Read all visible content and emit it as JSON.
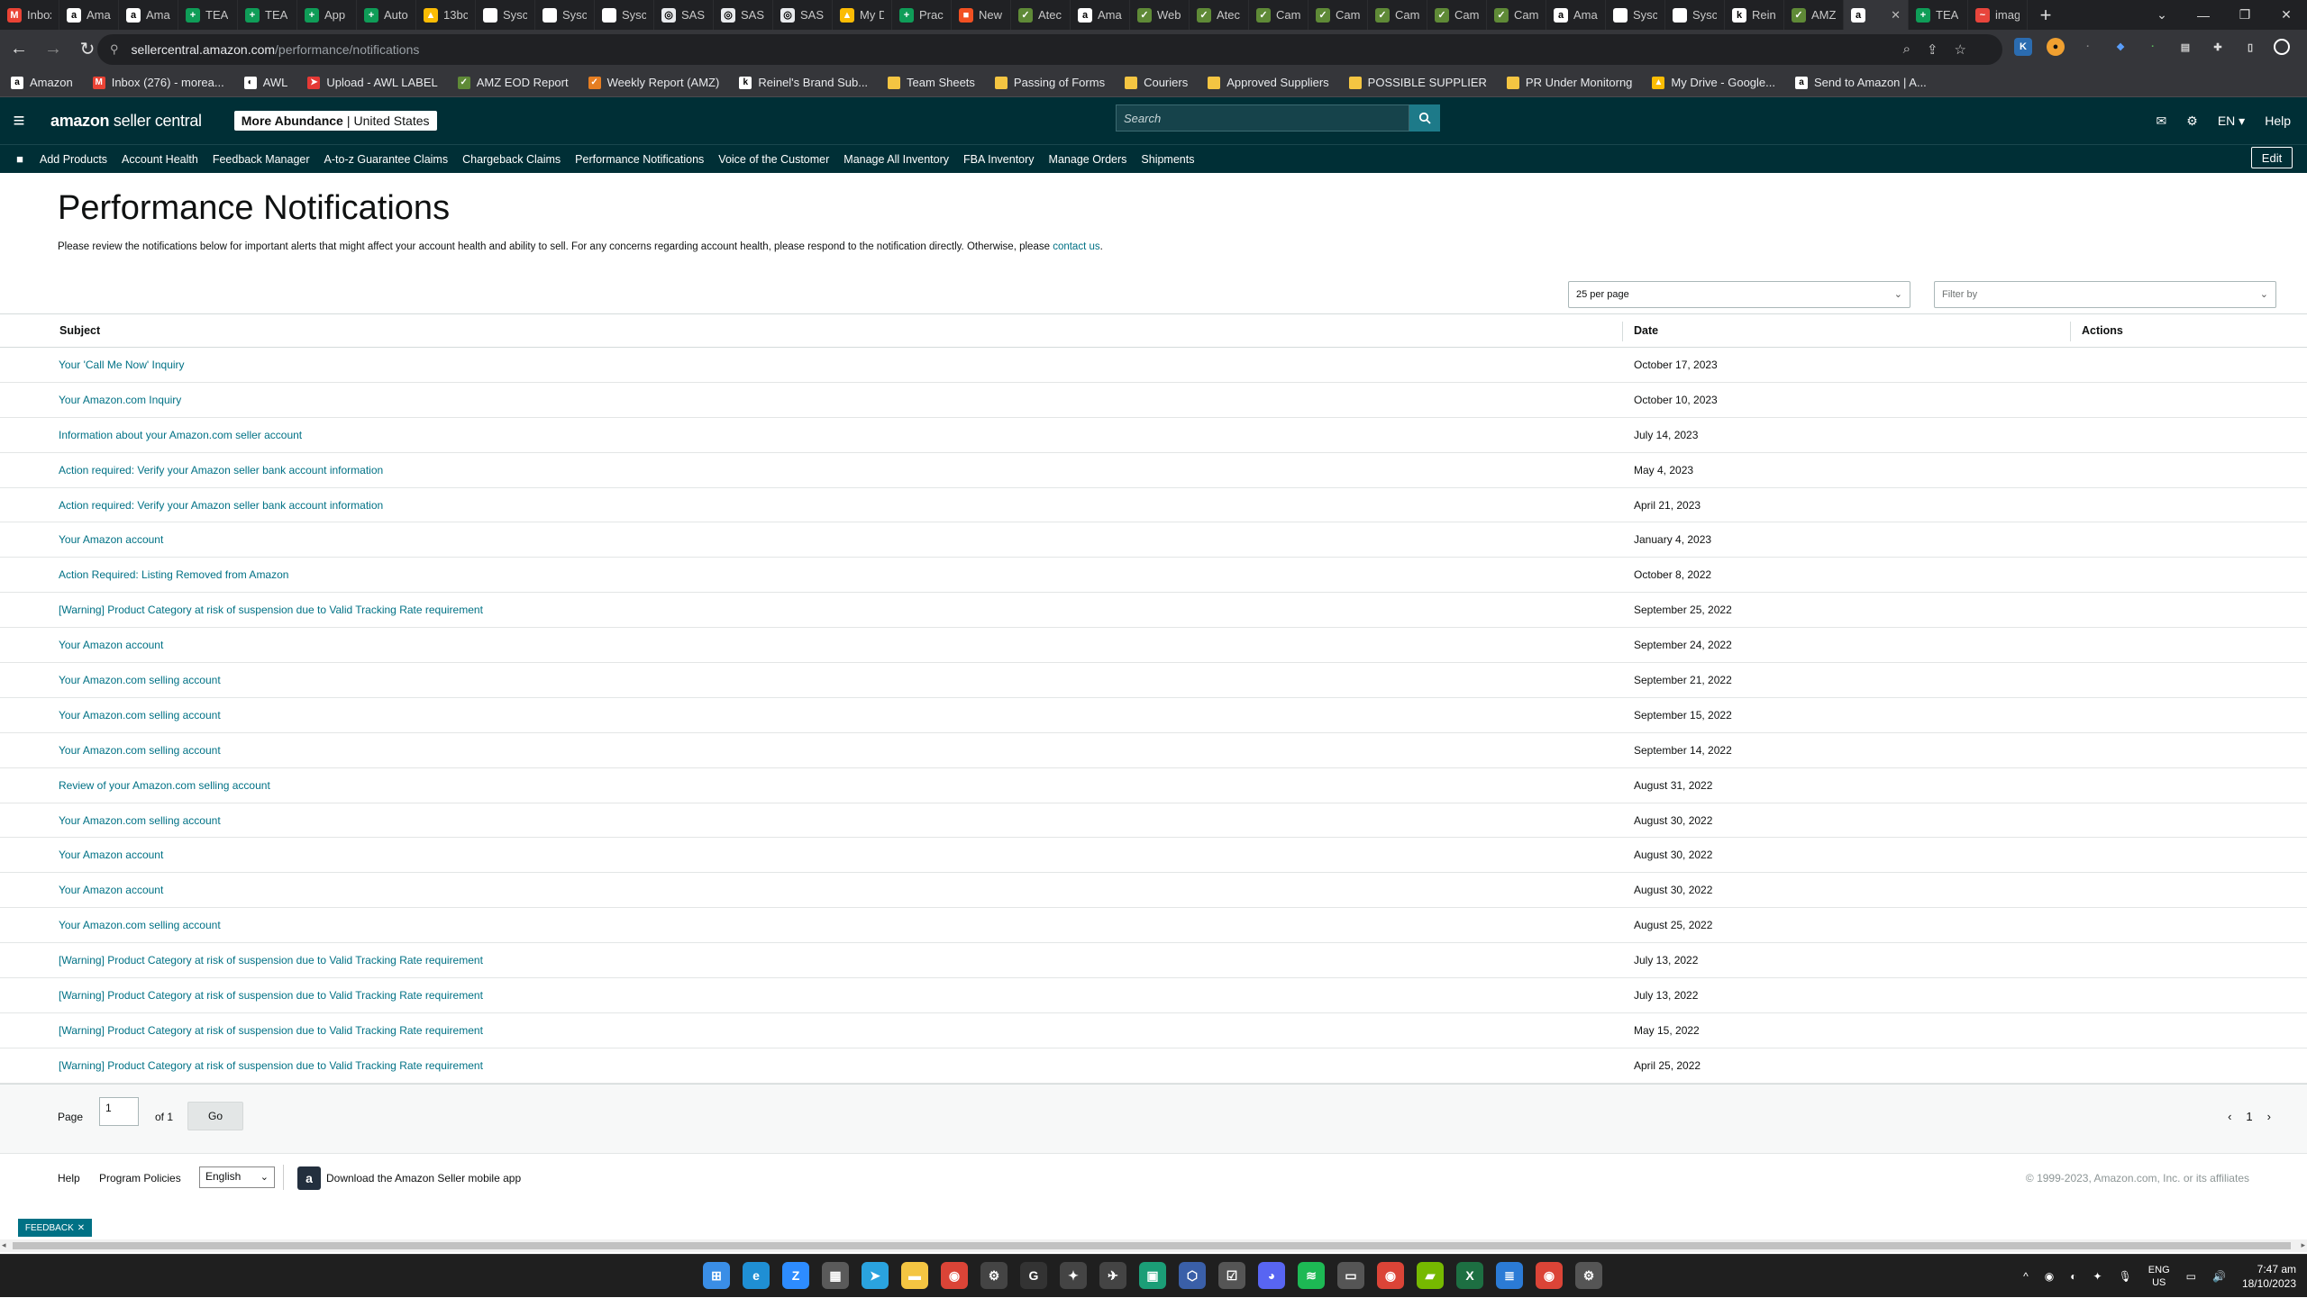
{
  "browser": {
    "tabs": [
      {
        "label": "Inbox",
        "icon": "gmail-icon",
        "color": "#ea4335",
        "glyph": "M"
      },
      {
        "label": "Ama",
        "icon": "amazon-icon",
        "color": "#ffffff",
        "glyph": "a"
      },
      {
        "label": "Ama",
        "icon": "amazon-icon",
        "color": "#ffffff",
        "glyph": "a"
      },
      {
        "label": "TEA",
        "icon": "sheets-icon",
        "color": "#0f9d58",
        "glyph": "+"
      },
      {
        "label": "TEA",
        "icon": "sheets-icon",
        "color": "#0f9d58",
        "glyph": "+"
      },
      {
        "label": "App",
        "icon": "sheets-icon",
        "color": "#0f9d58",
        "glyph": "+"
      },
      {
        "label": "Auto",
        "icon": "sheets-icon",
        "color": "#0f9d58",
        "glyph": "+"
      },
      {
        "label": "13bc",
        "icon": "drive-icon",
        "color": "#fbbc04",
        "glyph": "▲"
      },
      {
        "label": "Sysc",
        "icon": "doc-icon",
        "color": "#ffffff",
        "glyph": ""
      },
      {
        "label": "Sysc",
        "icon": "doc-icon",
        "color": "#ffffff",
        "glyph": ""
      },
      {
        "label": "Sysc",
        "icon": "doc-icon",
        "color": "#ffffff",
        "glyph": ""
      },
      {
        "label": "SAS",
        "icon": "chrome-icon",
        "color": "#e8eaed",
        "glyph": "◎"
      },
      {
        "label": "SAS",
        "icon": "chrome-icon",
        "color": "#e8eaed",
        "glyph": "◎"
      },
      {
        "label": "SAS",
        "icon": "chrome-icon",
        "color": "#e8eaed",
        "glyph": "◎"
      },
      {
        "label": "My D",
        "icon": "drive-icon",
        "color": "#fbbc04",
        "glyph": "▲"
      },
      {
        "label": "Prac",
        "icon": "sheets-icon",
        "color": "#0f9d58",
        "glyph": "+"
      },
      {
        "label": "New",
        "icon": "windows-icon",
        "color": "#f25022",
        "glyph": "■"
      },
      {
        "label": "Atec",
        "icon": "web-icon",
        "color": "#5f8a37",
        "glyph": "✓"
      },
      {
        "label": "Ama",
        "icon": "amazon-icon",
        "color": "#ffffff",
        "glyph": "a"
      },
      {
        "label": "Web",
        "icon": "web-icon",
        "color": "#5f8a37",
        "glyph": "✓"
      },
      {
        "label": "Atec",
        "icon": "web-icon",
        "color": "#5f8a37",
        "glyph": "✓"
      },
      {
        "label": "Cam",
        "icon": "web-icon",
        "color": "#5f8a37",
        "glyph": "✓"
      },
      {
        "label": "Cam",
        "icon": "web-icon",
        "color": "#5f8a37",
        "glyph": "✓"
      },
      {
        "label": "Cam",
        "icon": "web-icon",
        "color": "#5f8a37",
        "glyph": "✓"
      },
      {
        "label": "Cam",
        "icon": "web-icon",
        "color": "#5f8a37",
        "glyph": "✓"
      },
      {
        "label": "Cam",
        "icon": "web-icon",
        "color": "#5f8a37",
        "glyph": "✓"
      },
      {
        "label": "Ama",
        "icon": "amazon-icon",
        "color": "#ffffff",
        "glyph": "a"
      },
      {
        "label": "Sysc",
        "icon": "doc-icon",
        "color": "#ffffff",
        "glyph": ""
      },
      {
        "label": "Sysc",
        "icon": "doc-icon",
        "color": "#ffffff",
        "glyph": ""
      },
      {
        "label": "Rein",
        "icon": "reinel-icon",
        "color": "#ffffff",
        "glyph": "k"
      },
      {
        "label": "AMZ",
        "icon": "web-icon",
        "color": "#5f8a37",
        "glyph": "✓"
      },
      {
        "label": "",
        "icon": "amazon-icon",
        "color": "#ffffff",
        "glyph": "a",
        "active": true
      },
      {
        "label": "TEA",
        "icon": "sheets-icon",
        "color": "#0f9d58",
        "glyph": "+"
      },
      {
        "label": "imag",
        "icon": "image-icon",
        "color": "#e8453c",
        "glyph": "~"
      }
    ],
    "url_host": "sellercentral.amazon.com",
    "url_path": "/performance/notifications",
    "bookmarks": [
      {
        "label": "Amazon",
        "icon": "amazon-icon",
        "color": "#ffffff",
        "glyph": "a"
      },
      {
        "label": "Inbox (276) - morea...",
        "icon": "gmail-icon",
        "color": "#ea4335",
        "glyph": "M"
      },
      {
        "label": "AWL",
        "icon": "awl-icon",
        "color": "#ffffff",
        "glyph": "◐"
      },
      {
        "label": "Upload - AWL LABEL",
        "icon": "upload-icon",
        "color": "#e53935",
        "glyph": "➤"
      },
      {
        "label": "AMZ EOD Report",
        "icon": "web-icon",
        "color": "#5f8a37",
        "glyph": "✓"
      },
      {
        "label": "Weekly Report (AMZ)",
        "icon": "report-icon",
        "color": "#e67e22",
        "glyph": "✓"
      },
      {
        "label": "Reinel's Brand Sub...",
        "icon": "reinel-icon",
        "color": "#ffffff",
        "glyph": "k"
      },
      {
        "label": "Team Sheets",
        "icon": "folder-icon",
        "color": "#f4c542",
        "glyph": ""
      },
      {
        "label": "Passing of Forms",
        "icon": "folder-icon",
        "color": "#f4c542",
        "glyph": ""
      },
      {
        "label": "Couriers",
        "icon": "folder-icon",
        "color": "#f4c542",
        "glyph": ""
      },
      {
        "label": "Approved Suppliers",
        "icon": "folder-icon",
        "color": "#f4c542",
        "glyph": ""
      },
      {
        "label": "POSSIBLE SUPPLIER",
        "icon": "folder-icon",
        "color": "#f4c542",
        "glyph": ""
      },
      {
        "label": "PR Under Monitorng",
        "icon": "folder-icon",
        "color": "#f4c542",
        "glyph": ""
      },
      {
        "label": "My Drive - Google...",
        "icon": "drive-icon",
        "color": "#fbbc04",
        "glyph": "▲"
      },
      {
        "label": "Send to Amazon | A...",
        "icon": "amazon-icon",
        "color": "#ffffff",
        "glyph": "a"
      }
    ]
  },
  "header": {
    "logo_brand": "amazon",
    "logo_rest": " seller central",
    "store_name": "More Abundance",
    "store_region": "United States",
    "search_placeholder": "Search",
    "lang": "EN",
    "help": "Help"
  },
  "nav": {
    "items": [
      "Add Products",
      "Account Health",
      "Feedback Manager",
      "A-to-z Guarantee Claims",
      "Chargeback Claims",
      "Performance Notifications",
      "Voice of the Customer",
      "Manage All Inventory",
      "FBA Inventory",
      "Manage Orders",
      "Shipments"
    ],
    "edit": "Edit"
  },
  "page": {
    "title": "Performance Notifications",
    "intro": "Please review the notifications below for important alerts that might affect your account health and ability to sell. For any concerns regarding account health, please respond to the notification directly. Otherwise, please ",
    "contact_link": "contact us",
    "intro_end": ".",
    "per_page": "25 per page",
    "filter_placeholder": "Filter by"
  },
  "table": {
    "headers": {
      "subject": "Subject",
      "date": "Date",
      "actions": "Actions"
    },
    "rows": [
      {
        "subject": "Your 'Call Me Now' Inquiry",
        "date": "October 17, 2023"
      },
      {
        "subject": "Your Amazon.com Inquiry",
        "date": "October 10, 2023"
      },
      {
        "subject": "Information about your Amazon.com seller account",
        "date": "July 14, 2023"
      },
      {
        "subject": "Action required: Verify your Amazon seller bank account information",
        "date": "May 4, 2023"
      },
      {
        "subject": "Action required: Verify your Amazon seller bank account information",
        "date": "April 21, 2023"
      },
      {
        "subject": "Your Amazon account",
        "date": "January 4, 2023"
      },
      {
        "subject": "Action Required: Listing Removed from Amazon",
        "date": "October 8, 2022"
      },
      {
        "subject": "[Warning] Product Category at risk of suspension due to Valid Tracking Rate requirement",
        "date": "September 25, 2022"
      },
      {
        "subject": "Your Amazon account",
        "date": "September 24, 2022"
      },
      {
        "subject": "Your Amazon.com selling account",
        "date": "September 21, 2022"
      },
      {
        "subject": "Your Amazon.com selling account",
        "date": "September 15, 2022"
      },
      {
        "subject": "Your Amazon.com selling account",
        "date": "September 14, 2022"
      },
      {
        "subject": "Review of your Amazon.com selling account",
        "date": "August 31, 2022"
      },
      {
        "subject": "Your Amazon.com selling account",
        "date": "August 30, 2022"
      },
      {
        "subject": "Your Amazon account",
        "date": "August 30, 2022"
      },
      {
        "subject": "Your Amazon account",
        "date": "August 30, 2022"
      },
      {
        "subject": "Your Amazon.com selling account",
        "date": "August 25, 2022"
      },
      {
        "subject": "[Warning] Product Category at risk of suspension due to Valid Tracking Rate requirement",
        "date": "July 13, 2022"
      },
      {
        "subject": "[Warning] Product Category at risk of suspension due to Valid Tracking Rate requirement",
        "date": "July 13, 2022"
      },
      {
        "subject": "[Warning] Product Category at risk of suspension due to Valid Tracking Rate requirement",
        "date": "May 15, 2022"
      },
      {
        "subject": "[Warning] Product Category at risk of suspension due to Valid Tracking Rate requirement",
        "date": "April 25, 2022"
      }
    ]
  },
  "pagination": {
    "page_label": "Page",
    "page_value": "1",
    "of_label": "of 1",
    "go": "Go",
    "current_page": "1"
  },
  "footer": {
    "help": "Help",
    "policies": "Program Policies",
    "language": "English",
    "app_text": "Download the Amazon Seller mobile app",
    "copyright": "© 1999-2023, Amazon.com, Inc. or its affiliates"
  },
  "feedback_tab": "FEEDBACK",
  "taskbar": {
    "apps": [
      {
        "name": "start-icon",
        "color": "#3a8ee6",
        "glyph": "⊞"
      },
      {
        "name": "edge-icon",
        "color": "#1f8fd4",
        "glyph": "e"
      },
      {
        "name": "zoom-icon",
        "color": "#2d8cff",
        "glyph": "Z"
      },
      {
        "name": "calculator-icon",
        "color": "#5a5a5a",
        "glyph": "▦"
      },
      {
        "name": "telegram-icon",
        "color": "#2aa3df",
        "glyph": "➤"
      },
      {
        "name": "file-explorer-icon",
        "color": "#f4c542",
        "glyph": "▬"
      },
      {
        "name": "chrome-icon",
        "color": "#db4437",
        "glyph": "◉"
      },
      {
        "name": "settings-icon",
        "color": "#444",
        "glyph": "⚙"
      },
      {
        "name": "app-g-icon",
        "color": "#333",
        "glyph": "G"
      },
      {
        "name": "app-sparkle-icon",
        "color": "#444",
        "glyph": "✦"
      },
      {
        "name": "app-plane-icon",
        "color": "#444",
        "glyph": "✈"
      },
      {
        "name": "app-bus-icon",
        "color": "#1b9e77",
        "glyph": "▣"
      },
      {
        "name": "vpn-icon",
        "color": "#3a5fa8",
        "glyph": "⬡"
      },
      {
        "name": "checkbox-app-icon",
        "color": "#555",
        "glyph": "☑"
      },
      {
        "name": "discord-icon",
        "color": "#5865f2",
        "glyph": "◕"
      },
      {
        "name": "spotify-icon",
        "color": "#1db954",
        "glyph": "≋"
      },
      {
        "name": "remote-icon",
        "color": "#555",
        "glyph": "▭"
      },
      {
        "name": "chrome-active-icon",
        "color": "#db4437",
        "glyph": "◉"
      },
      {
        "name": "nvidia-icon",
        "color": "#76b900",
        "glyph": "▰"
      },
      {
        "name": "excel-icon",
        "color": "#1d6f42",
        "glyph": "X"
      },
      {
        "name": "notepad-icon",
        "color": "#2b7bd6",
        "glyph": "≣"
      },
      {
        "name": "chrome-profile-icon",
        "color": "#db4437",
        "glyph": "◉"
      },
      {
        "name": "settings-gear-icon",
        "color": "#555",
        "glyph": "⚙"
      }
    ],
    "lang_top": "ENG",
    "lang_bottom": "US",
    "time": "7:47 am",
    "date": "18/10/2023"
  }
}
